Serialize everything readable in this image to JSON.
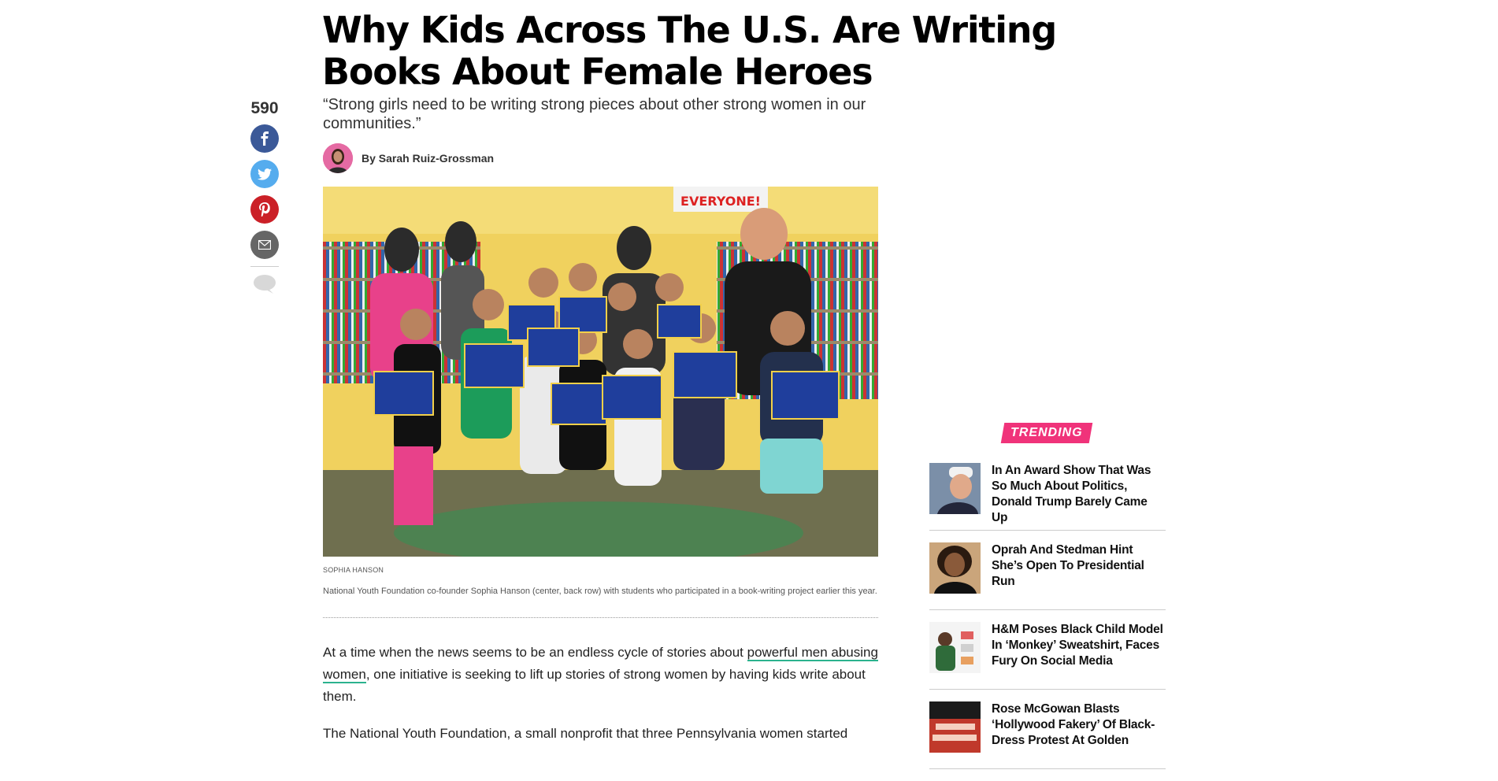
{
  "article": {
    "headline": "Why Kids Across The U.S. Are Writing Books About Female Heroes",
    "subhead": "“Strong girls need to be writing strong pieces about other strong women in our communities.”",
    "byline": "By Sarah Ruiz-Grossman"
  },
  "share": {
    "count": "590",
    "buttons": [
      {
        "icon": "facebook-icon",
        "color": "#3b5998"
      },
      {
        "icon": "twitter-icon",
        "color": "#55acee"
      },
      {
        "icon": "pinterest-icon",
        "color": "#cb2027"
      },
      {
        "icon": "email-icon",
        "color": "#666666"
      }
    ]
  },
  "image": {
    "credit": "SOPHIA HANSON",
    "caption": "National Youth Foundation co-founder Sophia Hanson (center, back row) with students who participated in a book-writing project earlier this year."
  },
  "body": {
    "p1_before": "At a time when the news seems to be an endless cycle of stories about ",
    "p1_link": "powerful men abusing women",
    "p1_after": ", one initiative is seeking to lift up stories of strong women by having kids write about them.",
    "p2": "The National Youth Foundation, a small nonprofit that three Pennsylvania women started"
  },
  "trending": {
    "label": "TRENDING",
    "items": [
      {
        "title": "In An Award Show That Was So Much About Politics, Donald Trump Barely Came Up"
      },
      {
        "title": "Oprah And Stedman Hint She’s Open To Presidential Run"
      },
      {
        "title": "H&M Poses Black Child Model In ‘Monkey’ Sweatshirt, Faces Fury On Social Media"
      },
      {
        "title": "Rose McGowan Blasts ‘Hollywood Fakery’ Of Black-Dress Protest At Golden"
      }
    ]
  },
  "colors": {
    "accent": "#f0337a",
    "link_underline": "#2bb28e"
  }
}
